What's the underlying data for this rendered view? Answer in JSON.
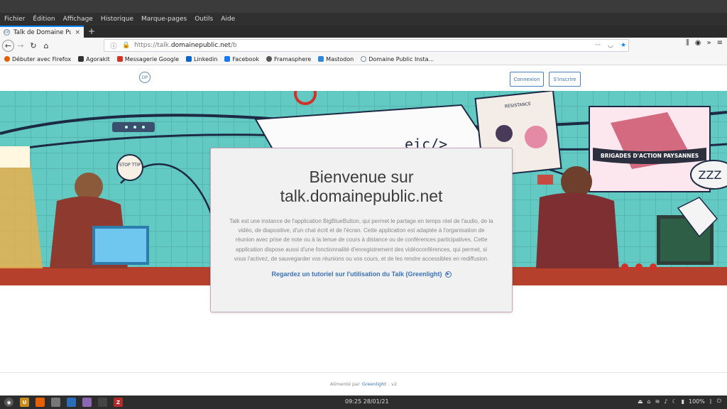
{
  "browser": {
    "menu": [
      "Fichier",
      "Édition",
      "Affichage",
      "Historique",
      "Marque-pages",
      "Outils",
      "Aide"
    ],
    "tab": {
      "title": "Talk de Domaine Public",
      "close": "×",
      "new": "+"
    },
    "nav": {
      "back": "←",
      "forward": "→",
      "reload": "↻",
      "home": "⌂"
    },
    "url": {
      "prefix": "https://talk.",
      "domain": "domainepublic.net",
      "suffix": "/b"
    },
    "url_actions": {
      "more": "···",
      "pocket": "◡",
      "star": "★"
    },
    "toolbar_right": {
      "library": "⫼",
      "account": "◉",
      "overflow": "»",
      "menu": "≡"
    },
    "bookmarks": [
      {
        "label": "Débuter avec Firefox",
        "color": "#e66000"
      },
      {
        "label": "Agorakit",
        "color": "#333333"
      },
      {
        "label": "Messagerie Google",
        "color": "#d93025"
      },
      {
        "label": "Linkedin",
        "color": "#0a66c2"
      },
      {
        "label": "Facebook",
        "color": "#1877f2"
      },
      {
        "label": "Framasphere",
        "color": "#555555"
      },
      {
        "label": "Mastodon",
        "color": "#3088d4"
      },
      {
        "label": "Domaine Public Insta...",
        "color": "#7c8fa6"
      }
    ]
  },
  "page": {
    "logo": "DP",
    "login": "Connexion",
    "signup": "S'inscrire",
    "hero": {
      "stop_sign": "STOP TTIP",
      "paper_text": "eic/>",
      "banner": "BRIGADES D'ACTION PAYSANNES",
      "zzz": "ZZZ",
      "poster": "RÉSISTANCE"
    },
    "title_line1": "Bienvenue sur",
    "title_line2": "talk.domainepublic.net",
    "description": "Talk est une instance de l'application BigBlueButton, qui permet le partage en temps réel de l'audio, de la vidéo, de diapositive, d'un chat écrit et de l'écran. Cette application est adaptée à l'organisation de réunion avec prise de note ou à la tenue de cours à distance ou de conférences participatives. Cette application dispose aussi d'une fonctionnalité d'enregistrement des vidéoconférences, qui permet, si vous l'activez, de sauvegarder vos réunions ou vos cours, et de les rendre accessibles en rediffusion.",
    "tutorial_link": "Regardez un tutoriel sur l'utilisation du Talk (Greenlight)",
    "footer": {
      "prefix": "Alimenté par",
      "link": "Greenlight",
      "version": ". v2"
    }
  },
  "taskbar": {
    "clock": "09:25  28/01/21",
    "battery": "100%"
  },
  "colors": {
    "accent": "#3b73b9",
    "hero_bg": "#61c6c1",
    "taskbar": "#2d2d2d"
  }
}
